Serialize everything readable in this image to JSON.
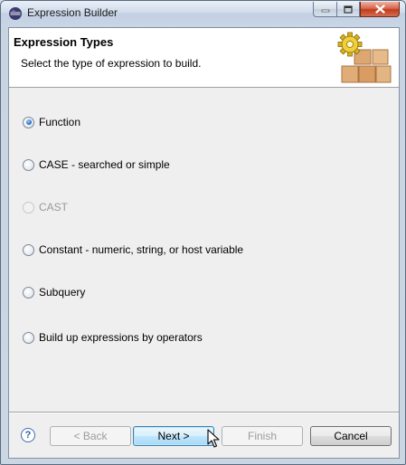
{
  "window": {
    "title": "Expression Builder"
  },
  "header": {
    "title": "Expression Types",
    "description": "Select the type of expression to build.",
    "graphic": "gear-and-blocks-icon"
  },
  "options": [
    {
      "label": "Function",
      "checked": true,
      "disabled": false
    },
    {
      "label": "CASE - searched or simple",
      "checked": false,
      "disabled": false
    },
    {
      "label": "CAST",
      "checked": false,
      "disabled": true
    },
    {
      "label": "Constant - numeric, string, or host variable",
      "checked": false,
      "disabled": false
    },
    {
      "label": "Subquery",
      "checked": false,
      "disabled": false
    },
    {
      "label": "Build up expressions by operators",
      "checked": false,
      "disabled": false
    }
  ],
  "footer": {
    "help_icon": "?",
    "back_label": "< Back",
    "next_label": "Next >",
    "finish_label": "Finish",
    "cancel_label": "Cancel"
  },
  "colors": {
    "primary_button": "#bee6fd",
    "disabled_text": "#9a9a9a"
  }
}
